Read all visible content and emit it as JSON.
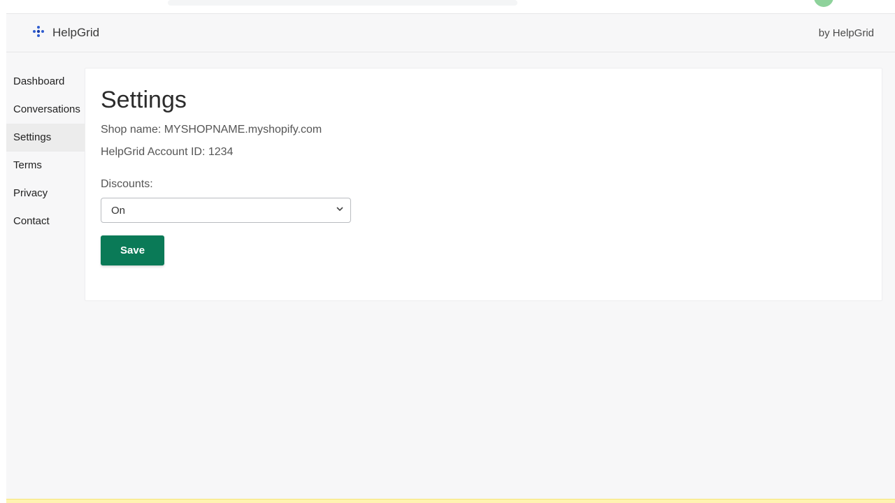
{
  "topstrip": {},
  "appbar": {
    "brand": "HelpGrid",
    "byline": "by HelpGrid"
  },
  "sidebar": {
    "items": [
      {
        "label": "Dashboard",
        "active": false
      },
      {
        "label": "Conversations",
        "active": false
      },
      {
        "label": "Settings",
        "active": true
      },
      {
        "label": "Terms",
        "active": false
      },
      {
        "label": "Privacy",
        "active": false
      },
      {
        "label": "Contact",
        "active": false
      }
    ]
  },
  "page": {
    "title": "Settings",
    "shop_line": "Shop name: MYSHOPNAME.myshopify.com",
    "account_line": "HelpGrid Account ID: 1234",
    "discounts_label": "Discounts:",
    "discounts_value": "On",
    "save_label": "Save"
  }
}
